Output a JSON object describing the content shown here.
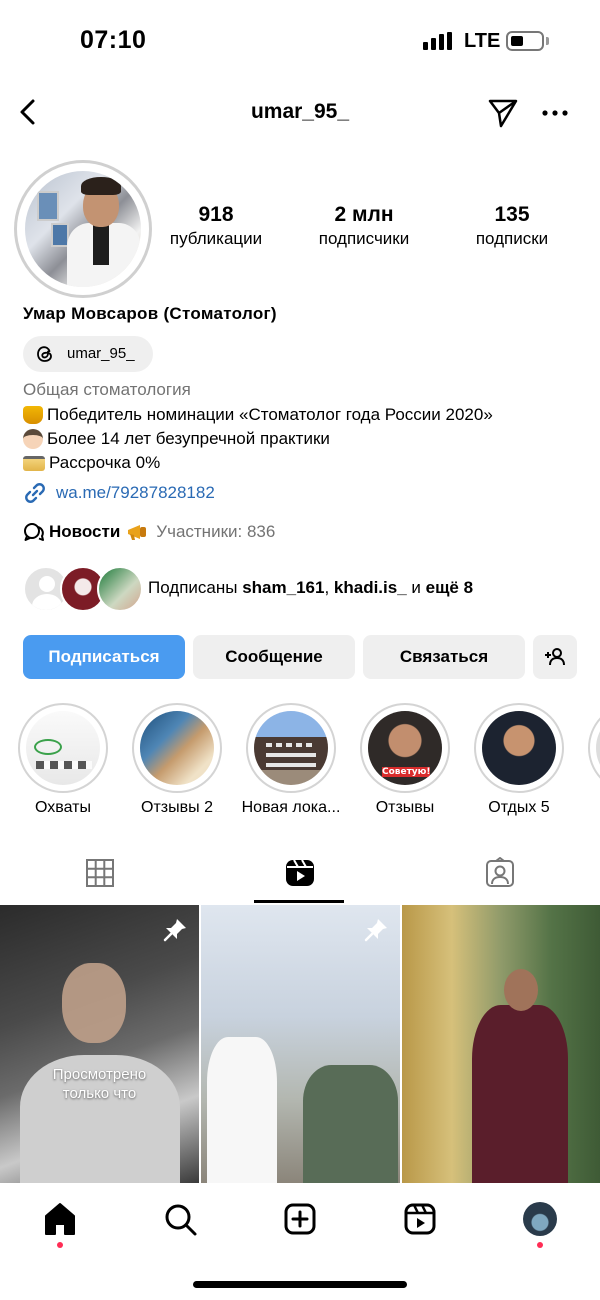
{
  "status_bar": {
    "time": "07:10",
    "network": "LTE"
  },
  "header": {
    "username": "umar_95_"
  },
  "stats": [
    {
      "value": "918",
      "label": "публикации"
    },
    {
      "value": "2 млн",
      "label": "подписчики"
    },
    {
      "value": "135",
      "label": "подписки"
    }
  ],
  "profile": {
    "name": "Умар Мовсаров (Стоматолог)",
    "threads_handle": "umar_95_",
    "category": "Общая стоматология",
    "bio": [
      {
        "icon": "trophy-emoji",
        "text": "Победитель номинации «Стоматолог года России 2020»"
      },
      {
        "icon": "doctor-emoji",
        "text": "Более 14 лет безупречной практики"
      },
      {
        "icon": "credit-card-emoji",
        "text": "Рассрочка 0%"
      }
    ],
    "link": "wa.me/79287828182",
    "channel": {
      "name": "Новости",
      "members": "Участники: 836"
    }
  },
  "followed_by": {
    "prefix": "Подписаны ",
    "user1": "sham_161",
    "sep": ", ",
    "user2": "khadi.is_",
    "and": " и ",
    "more": "ещё 8"
  },
  "actions": {
    "follow": "Подписаться",
    "message": "Сообщение",
    "contact": "Связаться"
  },
  "highlights": [
    {
      "label": "Охваты"
    },
    {
      "label": "Отзывы 2"
    },
    {
      "label": "Новая лока..."
    },
    {
      "label": "Отзывы"
    },
    {
      "label": "Отдых 5"
    },
    {
      "label": "К"
    }
  ],
  "tabs": [
    "grid-tab",
    "reels-tab",
    "tagged-tab"
  ],
  "posts": [
    {
      "pinned": true,
      "overlay_line1": "Просмотрено",
      "overlay_line2": "только что"
    },
    {
      "pinned": true
    },
    {
      "pinned": false
    }
  ],
  "colors": {
    "accent": "#4a9bf0",
    "link": "#2a6ab4",
    "secondary_text": "#737373",
    "notification_dot": "#ff2d55"
  }
}
